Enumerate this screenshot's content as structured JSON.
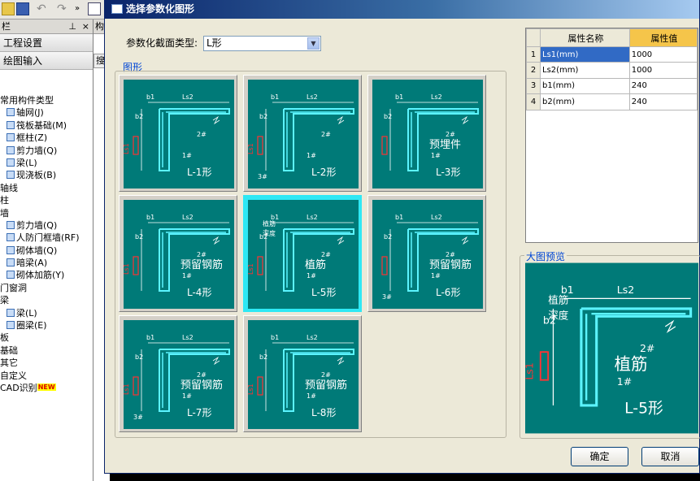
{
  "bg": {
    "panel_head": "栏",
    "pin_glyph": "ᛝ",
    "project_settings": "工程设置",
    "draw_input": "绘图输入",
    "search_fragment": "搜",
    "tab_fragment": "构",
    "tree": [
      {
        "label": "常用构件类型",
        "indent": 0
      },
      {
        "label": "轴网(J)",
        "indent": 10,
        "icon": true
      },
      {
        "label": "筏板基础(M)",
        "indent": 10,
        "icon": true
      },
      {
        "label": "框柱(Z)",
        "indent": 10,
        "icon": true
      },
      {
        "label": "剪力墙(Q)",
        "indent": 10,
        "icon": true
      },
      {
        "label": "梁(L)",
        "indent": 10,
        "icon": true
      },
      {
        "label": "现浇板(B)",
        "indent": 10,
        "icon": true
      },
      {
        "label": "轴线",
        "indent": 0
      },
      {
        "label": "柱",
        "indent": 0
      },
      {
        "label": "墙",
        "indent": 0
      },
      {
        "label": "剪力墙(Q)",
        "indent": 10,
        "icon": true
      },
      {
        "label": "人防门框墙(RF)",
        "indent": 10,
        "icon": true
      },
      {
        "label": "砌体墙(Q)",
        "indent": 10,
        "icon": true
      },
      {
        "label": "暗梁(A)",
        "indent": 10,
        "icon": true
      },
      {
        "label": "砌体加筋(Y)",
        "indent": 10,
        "icon": true
      },
      {
        "label": "门窗洞",
        "indent": 0
      },
      {
        "label": "梁",
        "indent": 0
      },
      {
        "label": "梁(L)",
        "indent": 10,
        "icon": true
      },
      {
        "label": "圈梁(E)",
        "indent": 10,
        "icon": true
      },
      {
        "label": "板",
        "indent": 0
      },
      {
        "label": "基础",
        "indent": 0
      },
      {
        "label": "其它",
        "indent": 0
      },
      {
        "label": "自定义",
        "indent": 0
      },
      {
        "label": "CAD识别",
        "indent": 0,
        "badge": "NEW"
      }
    ]
  },
  "dialog": {
    "title": "选择参数化图形",
    "type_label": "参数化截面类型:",
    "type_value": "L形",
    "group_label": "图形",
    "preview_label": "大图预览",
    "ok": "确定",
    "cancel": "取消"
  },
  "props": {
    "col_name": "属性名称",
    "col_value": "属性值",
    "rows": [
      {
        "n": "1",
        "name": "Ls1(mm)",
        "value": "1000"
      },
      {
        "n": "2",
        "name": "Ls2(mm)",
        "value": "1000"
      },
      {
        "n": "3",
        "name": "b1(mm)",
        "value": "240"
      },
      {
        "n": "4",
        "name": "b2(mm)",
        "value": "240"
      }
    ]
  },
  "shapes": [
    {
      "id": "L-1",
      "line1": "",
      "line2": "L-1形",
      "tags": [
        "b1",
        "Ls2",
        "b2",
        "2#",
        "1#",
        "Ls1"
      ],
      "selected": false
    },
    {
      "id": "L-2",
      "line1": "",
      "line2": "L-2形",
      "tags": [
        "b1",
        "Ls2",
        "b2",
        "2#",
        "1#",
        "3#",
        "Ls1"
      ],
      "selected": false
    },
    {
      "id": "L-3",
      "line1": "预埋件",
      "line2": "L-3形",
      "tags": [
        "Ls2",
        "b2",
        "b1",
        "2#",
        "1#"
      ],
      "selected": false
    },
    {
      "id": "L-4",
      "line1": "预留钢筋",
      "line2": "L-4形",
      "tags": [
        "2#",
        "Ls2",
        "b2",
        "b1",
        "1#",
        "Ls1"
      ],
      "selected": false
    },
    {
      "id": "L-5",
      "line1": "植筋",
      "line2": "L-5形",
      "tags": [
        "植筋",
        "深度",
        "2#",
        "Ls2",
        "b2",
        "b1",
        "1#",
        "Ls1"
      ],
      "selected": true
    },
    {
      "id": "L-6",
      "line1": "预留钢筋",
      "line2": "L-6形",
      "tags": [
        "Ls2",
        "b2",
        "3#",
        "b1",
        "2#",
        "1#"
      ],
      "selected": false
    },
    {
      "id": "L-7",
      "line1": "预留钢筋",
      "line2": "L-7形",
      "tags": [
        "Ls2",
        "b2",
        "3#",
        "b1",
        "2#",
        "1#",
        "Ls1"
      ],
      "selected": false
    },
    {
      "id": "L-8",
      "line1": "预留钢筋",
      "line2": "L-8形",
      "tags": [
        "Ls2",
        "b2",
        "2#",
        "b1",
        "1#",
        "Ls1"
      ],
      "selected": false
    }
  ],
  "preview": {
    "line1": "植筋",
    "line2": "L-5形",
    "tags": [
      "植筋",
      "深度",
      "2#",
      "Ls2",
      "b2",
      "b1",
      "1#",
      "Ls1"
    ]
  },
  "colors": {
    "teal": "#007a78",
    "rebar": "#5cf4ff",
    "dim": "#ffffff",
    "accent": "#f0cc50",
    "selected": "#2fe8f4",
    "ls1": "#ff3333"
  }
}
